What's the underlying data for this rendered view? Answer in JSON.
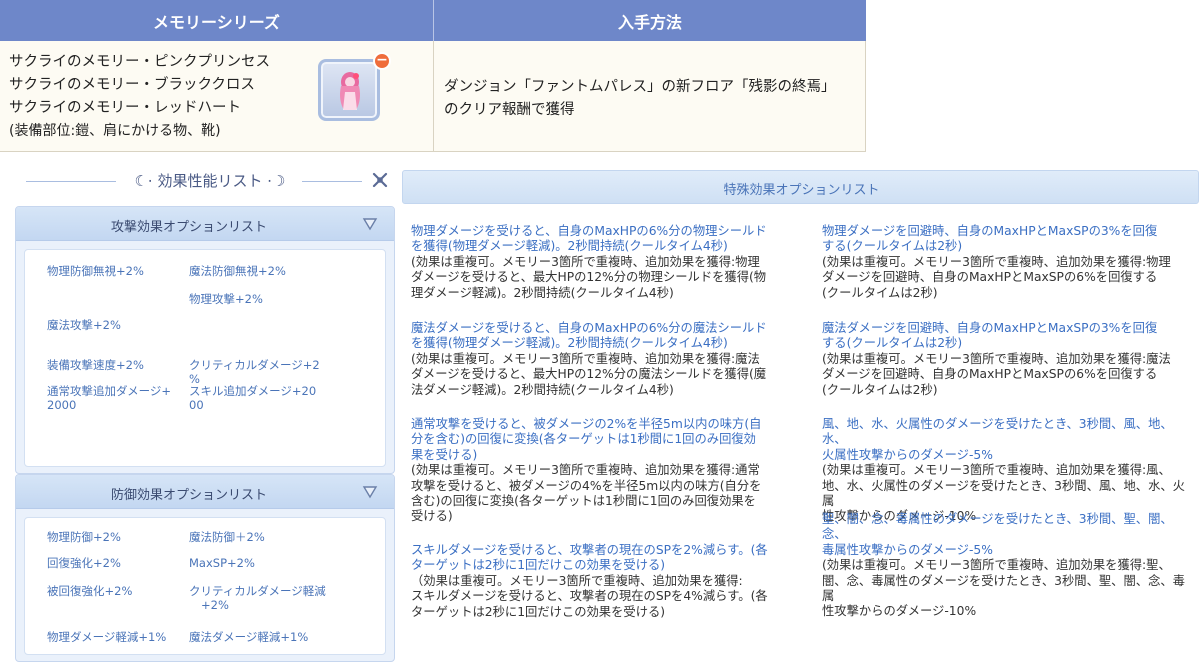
{
  "table": {
    "col1_header": "メモリーシリーズ",
    "col2_header": "入手方法",
    "items": [
      "サクライのメモリー・ピンクプリンセス",
      "サクライのメモリー・ブラッククロス",
      "サクライのメモリー・レッドハート"
    ],
    "equip_slots": "(装備部位:鎧、肩にかける物、靴)",
    "method_line1": "ダンジョン「ファントムパレス」の新フロア「残影の終焉」",
    "method_line2": "のクリア報酬で獲得"
  },
  "left_panel": {
    "title": "効果性能リスト",
    "attack_section": {
      "title": "攻撃効果オプションリスト",
      "options": [
        "物理防御無視+2%",
        "魔法防御無視+2%",
        "物理攻撃+2%",
        "魔法攻撃+2%",
        "装備攻撃速度+2%",
        "クリティカルダメージ+2",
        "%",
        "通常攻撃追加ダメージ+",
        "2000",
        "スキル追加ダメージ+20",
        "00"
      ]
    },
    "defense_section": {
      "title": "防御効果オプションリスト",
      "options": [
        "物理防御+2%",
        "魔法防御＋2%",
        "回復強化+2%",
        "MaxSP+2%",
        "被回復強化+2%",
        "クリティカルダメージ軽減",
        "+2%",
        "物理ダメージ軽減+1%",
        "魔法ダメージ軽減+1%"
      ]
    }
  },
  "right_panel": {
    "title": "特殊効果オプションリスト",
    "effects_left": [
      {
        "title": [
          "物理ダメージを受けると、自身のMaxHPの6%分の物理シールド",
          "を獲得(物理ダメージ軽減)。2秒間持続(クールタイム4秒)"
        ],
        "desc": [
          "(効果は重複可。メモリー3箇所で重複時、追加効果を獲得:物理",
          "ダメージを受けると、最大HPの12%分の物理シールドを獲得(物",
          "理ダメージ軽減)。2秒間持続(クールタイム4秒)"
        ]
      },
      {
        "title": [
          "魔法ダメージを受けると、自身のMaxHPの6%分の魔法シールド",
          "を獲得(物理ダメージ軽減)。2秒間持続(クールタイム4秒)"
        ],
        "desc": [
          "(効果は重複可。メモリー3箇所で重複時、追加効果を獲得:魔法",
          "ダメージを受けると、最大HPの12%分の魔法シールドを獲得(魔",
          "法ダメージ軽減)。2秒間持続(クールタイム4秒)"
        ]
      },
      {
        "title": [
          "通常攻撃を受けると、被ダメージの2%を半径5m以内の味方(自",
          "分を含む)の回復に変換(各ターゲットは1秒間に1回のみ回復効",
          "果を受ける)"
        ],
        "desc": [
          "(効果は重複可。メモリー3箇所で重複時、追加効果を獲得:通常",
          "攻撃を受けると、被ダメージの4%を半径5m以内の味方(自分を",
          "含む)の回復に変換(各ターゲットは1秒間に1回のみ回復効果を",
          "受ける)"
        ]
      },
      {
        "title": [
          "スキルダメージを受けると、攻撃者の現在のSPを2%減らす。(各",
          "ターゲットは2秒に1回だけこの効果を受ける)"
        ],
        "desc": [
          "（効果は重複可。メモリー3箇所で重複時、追加効果を獲得:",
          "スキルダメージを受けると、攻撃者の現在のSPを4%減らす。(各",
          "ターゲットは2秒に1回だけこの効果を受ける)"
        ]
      }
    ],
    "effects_right": [
      {
        "title": [
          "物理ダメージを回避時、自身のMaxHPとMaxSPの3%を回復",
          "する(クールタイムは2秒)"
        ],
        "desc": [
          "(効果は重複可。メモリー3箇所で重複時、追加効果を獲得:物理",
          "ダメージを回避時、自身のMaxHPとMaxSPの6%を回復する",
          "(クールタイムは2秒)"
        ]
      },
      {
        "title": [
          "魔法ダメージを回避時、自身のMaxHPとMaxSPの3%を回復",
          "する(クールタイムは2秒)"
        ],
        "desc": [
          "(効果は重複可。メモリー3箇所で重複時、追加効果を獲得:魔法",
          "ダメージを回避時、自身のMaxHPとMaxSPの6%を回復する",
          "(クールタイムは2秒)"
        ]
      },
      {
        "title": [
          "風、地、水、火属性のダメージを受けたとき、3秒間、風、地、水、",
          "火属性攻撃からのダメージ-5%"
        ],
        "desc": [
          "(効果は重複可。メモリー3箇所で重複時、追加効果を獲得:風、",
          "地、水、火属性のダメージを受けたとき、3秒間、風、地、水、火属",
          "性攻撃からのダメージ-10%"
        ]
      },
      {
        "title": [
          "聖、闇、念、毒属性のダメージを受けたとき、3秒間、聖、闇、念、",
          "毒属性攻撃からのダメージ-5%"
        ],
        "desc": [
          "(効果は重複可。メモリー3箇所で重複時、追加効果を獲得:聖、",
          "闇、念、毒属性のダメージを受けたとき、3秒間、聖、闇、念、毒属",
          "性攻撃からのダメージ-10%"
        ]
      }
    ]
  },
  "icons": {
    "close": "close-icon",
    "collapse": "triangle-down-icon",
    "item": "memory-item-icon",
    "remove": "minus-badge-icon"
  },
  "colors": {
    "header_blue": "#6e87c9",
    "link_blue": "#3b6fc3",
    "option_blue": "#4a74b8",
    "badge_orange": "#ef6d3c"
  }
}
